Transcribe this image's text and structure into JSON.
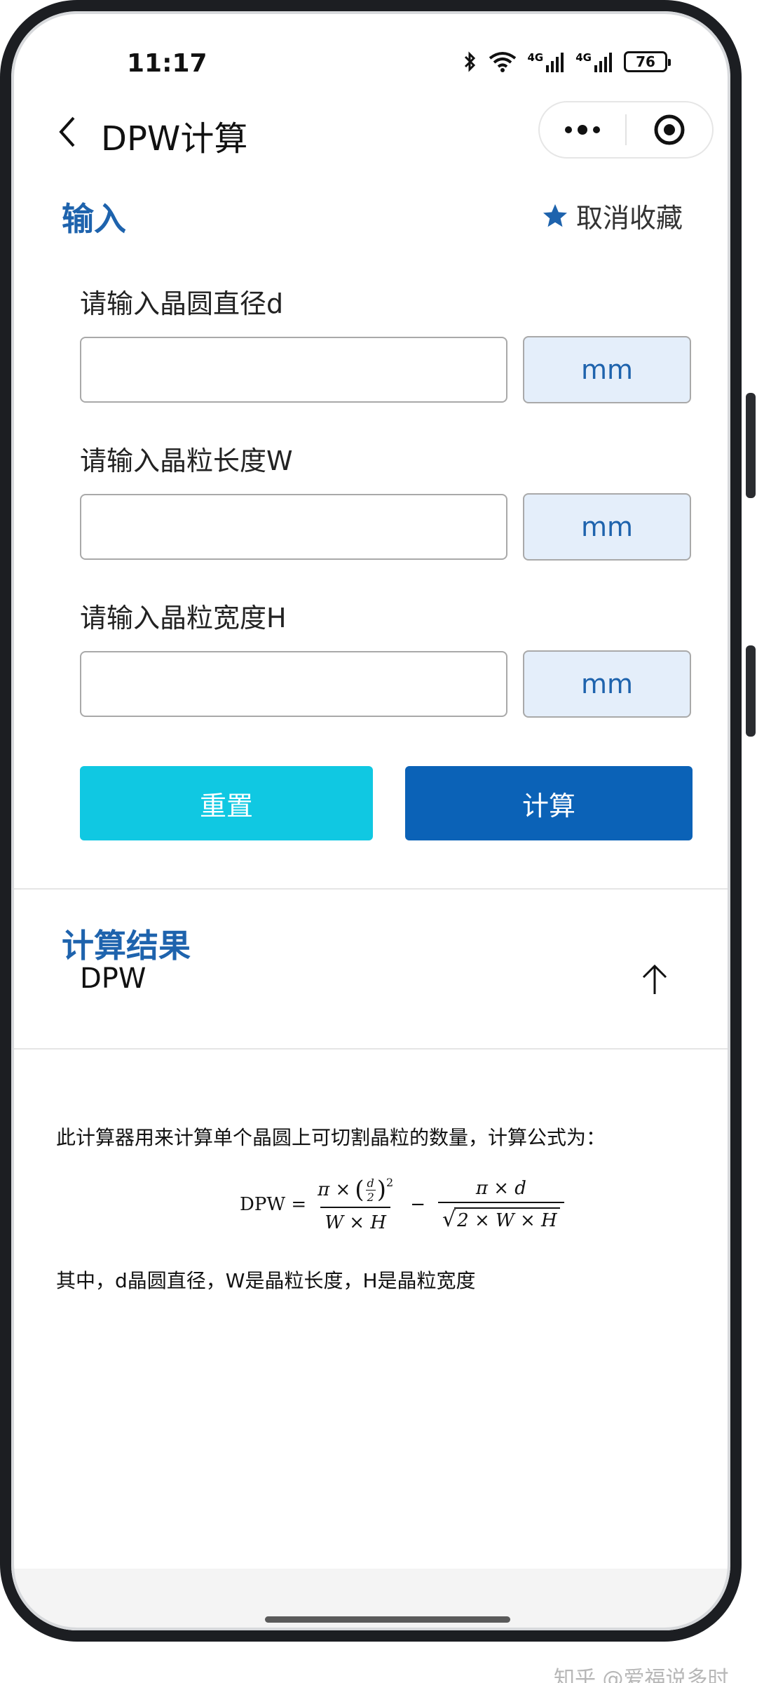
{
  "status_bar": {
    "time": "11:17",
    "battery": "76",
    "network_1": "4G",
    "network_2": "4G"
  },
  "nav": {
    "title": "DPW计算"
  },
  "input_section": {
    "title": "输入",
    "favorite_label": "取消收藏",
    "fields": [
      {
        "label": "请输入晶圆直径d",
        "value": "",
        "unit": "mm"
      },
      {
        "label": "请输入晶粒长度W",
        "value": "",
        "unit": "mm"
      },
      {
        "label": "请输入晶粒宽度H",
        "value": "",
        "unit": "mm"
      }
    ],
    "reset_label": "重置",
    "calc_label": "计算"
  },
  "result_section": {
    "title": "计算结果",
    "label": "DPW"
  },
  "description": {
    "intro": "此计算器用来计算单个晶圆上可切割晶粒的数量，计算公式为：",
    "formula": {
      "lhs": "DPW =",
      "term1_num_pi": "π ×",
      "term1_num_d": "d",
      "term1_num_2": "2",
      "term1_exp": "2",
      "term1_den": "W × H",
      "minus": "−",
      "term2_num": "π × d",
      "term2_den": "2 × W × H"
    },
    "note": "其中，d晶圆直径，W是晶粒长度，H是晶粒宽度"
  },
  "watermark": "知乎 @爱福说多时",
  "colors": {
    "accent": "#1e63ad",
    "reset_button": "#10c8e2",
    "calc_button": "#0b62b7",
    "unit_bg": "#e4eefa"
  }
}
